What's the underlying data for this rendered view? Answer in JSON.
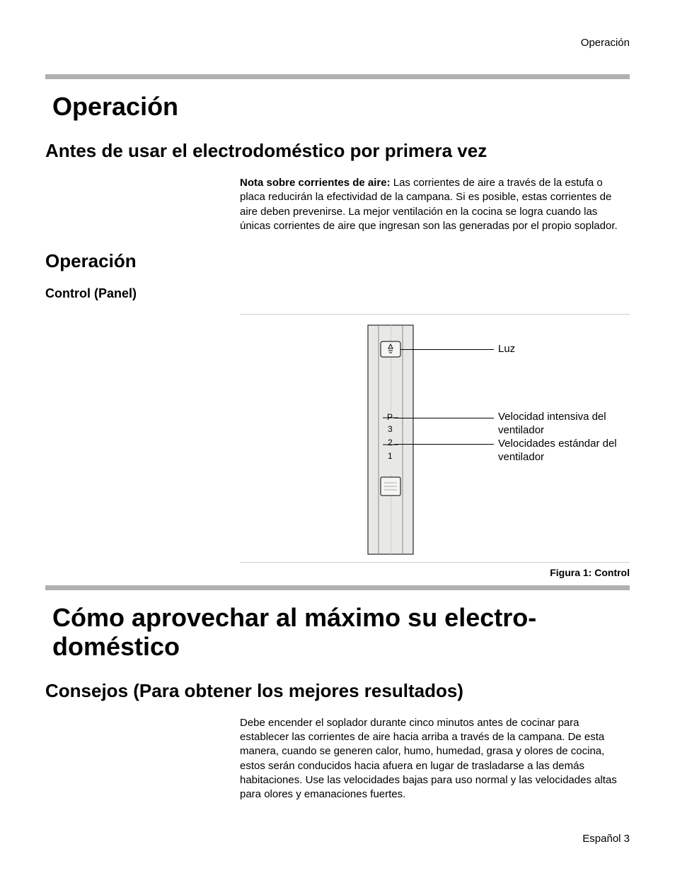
{
  "running_head": "Operación",
  "section1": {
    "title": "Operación",
    "h2": "Antes de usar el electrodoméstico por primera vez",
    "note_label": "Nota sobre corrientes de aire:",
    "note_text": " Las corrientes de aire a través de la estufa o placa reducirán la efectividad de la campana. Si es posible, estas corrientes de aire deben prevenirse. La mejor ventilación en la cocina se logra cuando las únicas corrientes de aire que ingresan son las generadas por el propio soplador.",
    "h2b": "Operación",
    "h3": "Control (Panel)"
  },
  "figure": {
    "callout_light": "Luz",
    "callout_intensive": "Velocidad intensiva del ventilador",
    "callout_standard": "Velocidades estándar del ventilador",
    "speed_P": "P",
    "speed_3": "3",
    "speed_2": "2",
    "speed_1": "1",
    "caption": "Figura 1: Control"
  },
  "section2": {
    "title": "Cómo aprovechar al máximo su electro­doméstico",
    "h2": "Consejos (Para obtener los mejores resultados)",
    "body": "Debe encender el soplador durante cinco minutos antes de cocinar para establecer las corrientes de aire hacia arriba a través de la campana. De esta manera, cuando se generen calor, humo, humedad, grasa y olores de cocina, estos serán conducidos hacia afuera en lugar de trasladarse a las demás habitaciones. Use las velocidades bajas para uso normal y las velocidades altas para olores y emanaciones fuertes."
  },
  "footer": "Español 3"
}
